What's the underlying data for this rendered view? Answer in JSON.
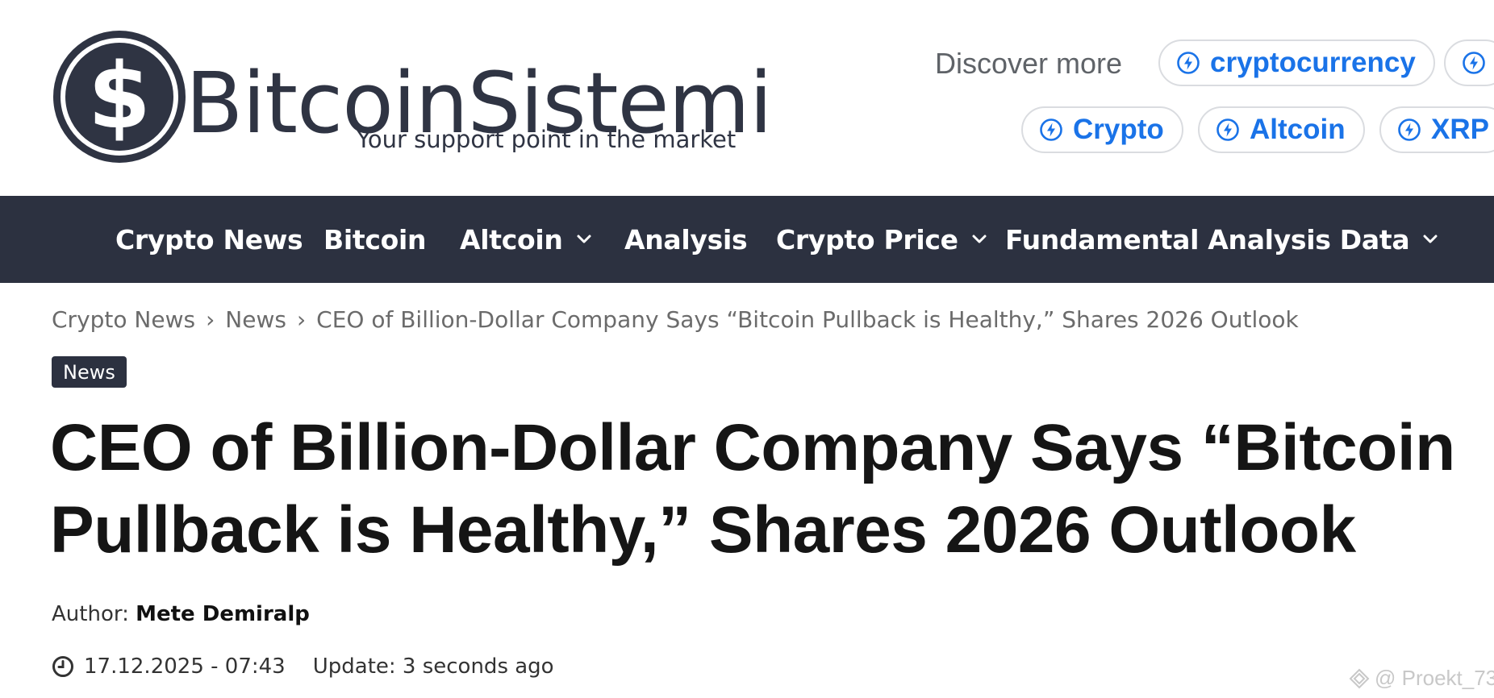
{
  "header": {
    "logo": {
      "name": "BitcoinSistemi",
      "tagline": "Your support point in the market",
      "icon": "bitcoin-logo-icon"
    },
    "discover": {
      "label": "Discover more",
      "chips": [
        {
          "label": "cryptocurrency",
          "icon": "bolt-circle-icon"
        },
        {
          "label": "",
          "icon": "bolt-circle-icon"
        },
        {
          "label": "Crypto",
          "icon": "bolt-circle-icon"
        },
        {
          "label": "Altcoin",
          "icon": "bolt-circle-icon"
        },
        {
          "label": "XRP",
          "icon": "bolt-circle-icon"
        }
      ]
    }
  },
  "nav": {
    "items": [
      {
        "label": "Crypto News",
        "has_dropdown": false
      },
      {
        "label": "Bitcoin",
        "has_dropdown": false
      },
      {
        "label": "Altcoin",
        "has_dropdown": true
      },
      {
        "label": "Analysis",
        "has_dropdown": false
      },
      {
        "label": "Crypto Price",
        "has_dropdown": true
      },
      {
        "label": "Fundamental Analysis Data",
        "has_dropdown": true
      }
    ]
  },
  "breadcrumb": {
    "items": [
      "Crypto News",
      "News",
      "CEO of Billion-Dollar Company Says “Bitcoin Pullback is Healthy,” Shares 2026 Outlook"
    ],
    "separator": "›"
  },
  "article": {
    "category": "News",
    "title": "CEO of Billion-Dollar Company Says “Bitcoin Pullback is Healthy,” Shares 2026 Outlook",
    "author_label": "Author:",
    "author_name": "Mete Demiralp",
    "date": "17.12.2025 - 07:43",
    "update": "Update: 3 seconds ago"
  },
  "watermark": {
    "text": "@ Proekt_73"
  },
  "colors": {
    "nav_bg": "#2c3140",
    "chip_text": "#1a73e8",
    "logo": "#2f3443"
  }
}
